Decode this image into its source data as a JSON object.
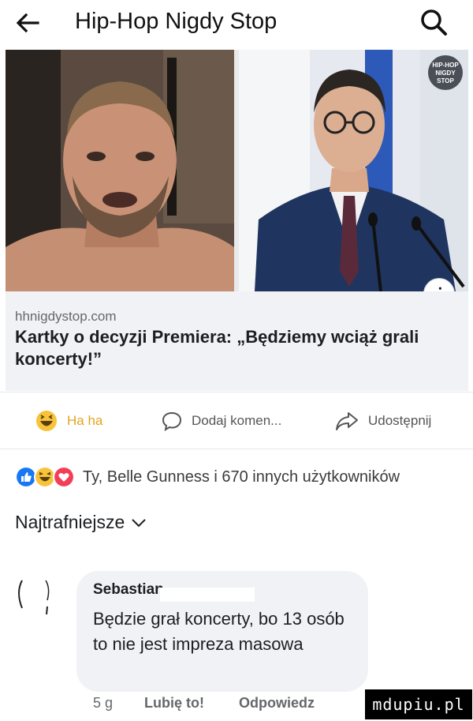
{
  "header": {
    "title": "Hip-Hop Nigdy Stop"
  },
  "preview": {
    "domain": "hhnigdystop.com",
    "headline": "Kartky o decyzji Premiera: „Będziemy wciąż grali koncerty!”",
    "brand_logo_text": [
      "HIP-HOP",
      "NIGDY",
      "STOP"
    ],
    "info_icon": "i"
  },
  "actions": {
    "haha": "Ha ha",
    "comment": "Dodaj komen...",
    "share": "Udostępnij"
  },
  "reactions": {
    "icons": [
      "like-icon",
      "haha-icon",
      "love-icon"
    ],
    "text": "Ty, Belle Gunness i 670 innych użytkowników"
  },
  "sort_label": "Najtrafniejsze",
  "comment": {
    "author": "Sebastian",
    "text": "Będzie grał koncerty, bo 13 osób to nie jest impreza masowa",
    "time": "5 g",
    "like": "Lubię to!",
    "reply": "Odpowiedz"
  },
  "watermark": "mdupiu.pl",
  "colors": {
    "like": "#1877f2",
    "haha": "#f7b125",
    "love": "#f33e58",
    "link_bg": "#f0f2f5"
  }
}
